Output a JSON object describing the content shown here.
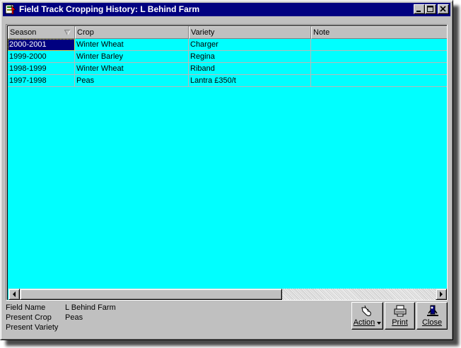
{
  "window": {
    "title": "Field Track Cropping History: L Behind Farm"
  },
  "grid": {
    "columns": [
      "Season",
      "Crop",
      "Variety",
      "Note"
    ],
    "rows": [
      {
        "season": "2000-2001",
        "crop": "Winter Wheat",
        "variety": "Charger",
        "note": ""
      },
      {
        "season": "1999-2000",
        "crop": "Winter Barley",
        "variety": "Regina",
        "note": ""
      },
      {
        "season": "1998-1999",
        "crop": "Winter Wheat",
        "variety": "Riband",
        "note": ""
      },
      {
        "season": "1997-1998",
        "crop": "Peas",
        "variety": "Lantra £350/t",
        "note": ""
      }
    ],
    "background_color": "#00ffff",
    "selection_color": "#000080"
  },
  "info": {
    "field_name_label": "Field Name",
    "field_name_value": "L Behind Farm",
    "present_crop_label": "Present Crop",
    "present_crop_value": "Peas",
    "present_variety_label": "Present Variety",
    "present_variety_value": ""
  },
  "buttons": {
    "action": "Action",
    "print": "Print",
    "close": "Close"
  },
  "colors": {
    "titlebar": "#000080",
    "face": "#c0c0c0"
  }
}
